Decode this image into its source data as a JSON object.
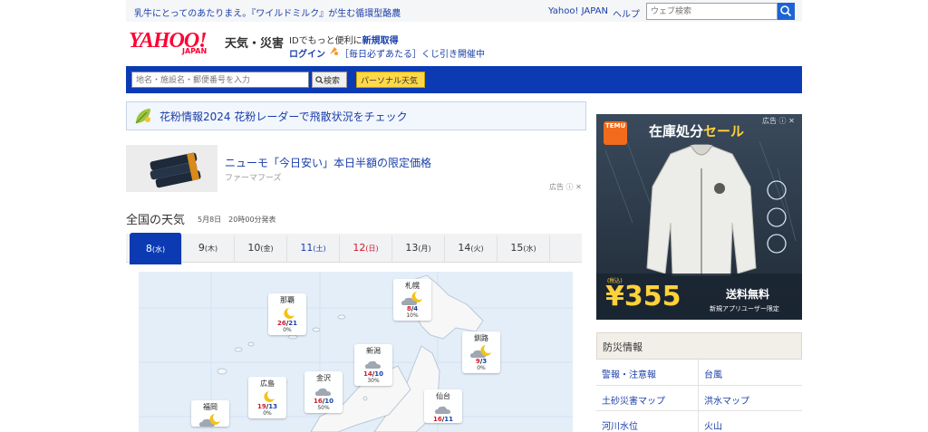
{
  "header": {
    "promo_text": "乳牛にとってのあたりまえ。『ワイルドミルク』が生む循環型酪農",
    "links": [
      "Yahoo! JAPAN",
      "ヘルプ"
    ],
    "search_placeholder": "ウェブ検索"
  },
  "brand": {
    "logo_text": "YAHOO!",
    "logo_sub": "JAPAN",
    "service_name": "天気・災害",
    "id_prefix": "IDでもっと便利に",
    "id_link": "新規取得",
    "login": "ログイン",
    "lottery": "［毎日必ずあたる］くじ引き開催中"
  },
  "nav": {
    "location_placeholder": "地名・施設名・郵便番号を入力",
    "search_button": "検索",
    "personal_button": "パーソナル天気"
  },
  "pollen_banner": {
    "text": "花粉情報2024 花粉レーダーで飛散状況をチェック"
  },
  "ad": {
    "title": "ニューモ「今日安い」本日半額の限定価格",
    "sponsor": "ファーマフーズ",
    "ad_label": "広告"
  },
  "national": {
    "title": "全国の天気",
    "announce": "5月8日　20時00分発表",
    "tabs": [
      {
        "day": "8",
        "wd": "水",
        "type": "weekday",
        "active": true
      },
      {
        "day": "9",
        "wd": "木",
        "type": "weekday",
        "active": false
      },
      {
        "day": "10",
        "wd": "金",
        "type": "weekday",
        "active": false
      },
      {
        "day": "11",
        "wd": "土",
        "type": "sat",
        "active": false
      },
      {
        "day": "12",
        "wd": "日",
        "type": "sun",
        "active": false
      },
      {
        "day": "13",
        "wd": "月",
        "type": "weekday",
        "active": false
      },
      {
        "day": "14",
        "wd": "火",
        "type": "weekday",
        "active": false
      },
      {
        "day": "15",
        "wd": "水",
        "type": "weekday",
        "active": false
      }
    ],
    "cities": [
      {
        "name": "那覇",
        "icon": "moon",
        "hi": "26",
        "lo": "21",
        "pop": "0%"
      },
      {
        "name": "札幌",
        "icon": "moon-cloud",
        "hi": "8",
        "lo": "4",
        "pop": "10%"
      },
      {
        "name": "釧路",
        "icon": "cloud-moon",
        "hi": "9",
        "lo": "3",
        "pop": "0%"
      },
      {
        "name": "新潟",
        "icon": "cloud",
        "hi": "14",
        "lo": "10",
        "pop": "30%"
      },
      {
        "name": "広島",
        "icon": "moon",
        "hi": "19",
        "lo": "13",
        "pop": "0%"
      },
      {
        "name": "金沢",
        "icon": "cloud",
        "hi": "16",
        "lo": "10",
        "pop": "50%"
      },
      {
        "name": "仙台",
        "icon": "cloud",
        "hi": "16",
        "lo": "11",
        "pop": ""
      },
      {
        "name": "福岡",
        "icon": "cloud-moon",
        "hi": "",
        "lo": "",
        "pop": ""
      }
    ]
  },
  "side_ad": {
    "brand": "TEMU",
    "title_prefix": "在庫処分",
    "title_sale": "セール",
    "price": "¥355",
    "price_tag": "(税込)",
    "shipping": "送料無料",
    "note": "新規アプリユーザー限定",
    "ad_label": "広告"
  },
  "disaster": {
    "heading": "防災情報",
    "items": [
      "警報・注意報",
      "台風",
      "土砂災害マップ",
      "洪水マップ",
      "河川水位",
      "火山"
    ]
  },
  "colors": {
    "link": "#1a3ea8",
    "nav_bar": "#0b3ab3",
    "hi_temp": "#d0192b",
    "lo_temp": "#1a3ea8"
  }
}
